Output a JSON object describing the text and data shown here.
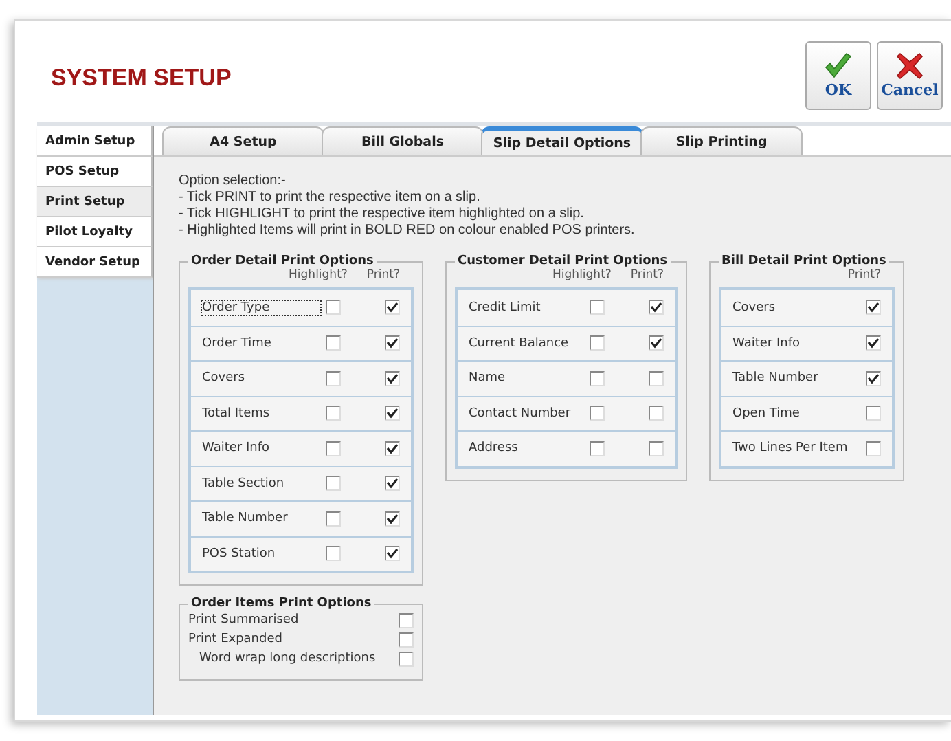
{
  "title": "SYSTEM SETUP",
  "buttons": [
    {
      "kind": "ok",
      "label": "OK"
    },
    {
      "kind": "cancel",
      "label": "Cancel"
    }
  ],
  "side_tabs": [
    {
      "label": "Admin Setup",
      "selected": false
    },
    {
      "label": "POS Setup",
      "selected": false
    },
    {
      "label": "Print Setup",
      "selected": true
    },
    {
      "label": "Pilot Loyalty",
      "selected": false
    },
    {
      "label": "Vendor Setup",
      "selected": false
    }
  ],
  "tabs": [
    {
      "label": "A4 Setup",
      "selected": false
    },
    {
      "label": "Bill Globals",
      "selected": false
    },
    {
      "label": "Slip Detail Options",
      "selected": true
    },
    {
      "label": "Slip Printing",
      "selected": false
    }
  ],
  "instructions": [
    "Option selection:-",
    "- Tick PRINT to print the respective item on a slip.",
    "- Tick HIGHLIGHT to print the respective item highlighted on a slip.",
    "- Highlighted Items will print in BOLD RED on colour enabled POS printers."
  ],
  "groups": [
    {
      "title": "Order Detail Print Options",
      "headers": [
        "Highlight?",
        "Print?"
      ],
      "rows": [
        {
          "label": "Order Type",
          "focused": true,
          "highlight": false,
          "print": true
        },
        {
          "label": "Order Time",
          "focused": false,
          "highlight": false,
          "print": true
        },
        {
          "label": "Covers",
          "focused": false,
          "highlight": false,
          "print": true
        },
        {
          "label": "Total Items",
          "focused": false,
          "highlight": false,
          "print": true
        },
        {
          "label": "Waiter Info",
          "focused": false,
          "highlight": false,
          "print": true
        },
        {
          "label": "Table Section",
          "focused": false,
          "highlight": false,
          "print": true
        },
        {
          "label": "Table Number",
          "focused": false,
          "highlight": false,
          "print": true
        },
        {
          "label": "POS Station",
          "focused": false,
          "highlight": false,
          "print": true
        }
      ]
    },
    {
      "title": "Customer Detail Print Options",
      "headers": [
        "Highlight?",
        "Print?"
      ],
      "rows": [
        {
          "label": "Credit Limit",
          "focused": false,
          "highlight": false,
          "print": true
        },
        {
          "label": "Current Balance",
          "focused": false,
          "highlight": false,
          "print": true
        },
        {
          "label": "Name",
          "focused": false,
          "highlight": false,
          "print": false
        },
        {
          "label": "Contact Number",
          "focused": false,
          "highlight": false,
          "print": false
        },
        {
          "label": "Address",
          "focused": false,
          "highlight": false,
          "print": false
        }
      ]
    },
    {
      "title": "Bill Detail Print Options",
      "headers": [
        "Print?"
      ],
      "rows": [
        {
          "label": "Covers",
          "focused": false,
          "print": true
        },
        {
          "label": "Waiter Info",
          "focused": false,
          "print": true
        },
        {
          "label": "Table Number",
          "focused": false,
          "print": true
        },
        {
          "label": "Open Time",
          "focused": false,
          "print": false
        },
        {
          "label": "Two Lines Per Item",
          "focused": false,
          "print": false
        }
      ]
    }
  ],
  "order_items": {
    "title": "Order Items Print Options",
    "options": [
      {
        "label": "Print Summarised",
        "indented": false,
        "checked": false
      },
      {
        "label": "Print Expanded",
        "indented": false,
        "checked": false
      },
      {
        "label": "Word wrap long descriptions",
        "indented": true,
        "checked": false
      }
    ]
  }
}
